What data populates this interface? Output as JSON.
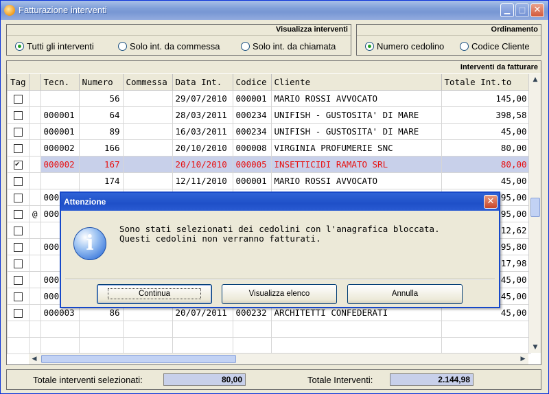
{
  "window": {
    "title": "Fatturazione interventi"
  },
  "filter_group": {
    "header": "Visualizza interventi",
    "options": [
      {
        "label": "Tutti gli interventi",
        "selected": true
      },
      {
        "label": "Solo int. da commessa",
        "selected": false
      },
      {
        "label": "Solo int. da chiamata",
        "selected": false
      }
    ]
  },
  "sort_group": {
    "header": "Ordinamento",
    "options": [
      {
        "label": "Numero cedolino",
        "selected": true
      },
      {
        "label": "Codice Cliente",
        "selected": false
      }
    ]
  },
  "grid": {
    "header": "Interventi da fatturare",
    "columns": [
      "Tag",
      "",
      "Tecn.",
      "Numero",
      "Commessa",
      "Data Int.",
      "Codice",
      "Cliente",
      "Totale Int.to"
    ],
    "rows": [
      {
        "tag": false,
        "flag": "",
        "tecn": "",
        "numero": "56",
        "commessa": "",
        "data": "29/07/2010",
        "codice": "000001",
        "cliente": "MARIO ROSSI AVVOCATO",
        "totale": "145,00"
      },
      {
        "tag": false,
        "flag": "",
        "tecn": "000001",
        "numero": "64",
        "commessa": "",
        "data": "28/03/2011",
        "codice": "000234",
        "cliente": "UNIFISH - GUSTOSITA' DI MARE",
        "totale": "398,58"
      },
      {
        "tag": false,
        "flag": "",
        "tecn": "000001",
        "numero": "89",
        "commessa": "",
        "data": "16/03/2011",
        "codice": "000234",
        "cliente": "UNIFISH - GUSTOSITA' DI MARE",
        "totale": "45,00"
      },
      {
        "tag": false,
        "flag": "",
        "tecn": "000002",
        "numero": "166",
        "commessa": "",
        "data": "20/10/2010",
        "codice": "000008",
        "cliente": "VIRGINIA PROFUMERIE SNC",
        "totale": "80,00"
      },
      {
        "tag": true,
        "flag": "",
        "tecn": "000002",
        "numero": "167",
        "commessa": "",
        "data": "20/10/2010",
        "codice": "000005",
        "cliente": "INSETTICIDI RAMATO SRL",
        "totale": "80,00",
        "selected": true
      },
      {
        "tag": false,
        "flag": "",
        "tecn": "",
        "numero": "174",
        "commessa": "",
        "data": "12/11/2010",
        "codice": "000001",
        "cliente": "MARIO ROSSI AVVOCATO",
        "totale": "45,00"
      },
      {
        "tag": false,
        "flag": "",
        "tecn": "000",
        "numero": "",
        "commessa": "",
        "data": "",
        "codice": "",
        "cliente": "",
        "totale": "95,00"
      },
      {
        "tag": false,
        "flag": "@",
        "tecn": "000",
        "numero": "",
        "commessa": "",
        "data": "",
        "codice": "",
        "cliente": "",
        "totale": "95,00"
      },
      {
        "tag": false,
        "flag": "",
        "tecn": "",
        "numero": "",
        "commessa": "",
        "data": "",
        "codice": "",
        "cliente": "",
        "totale": "12,62"
      },
      {
        "tag": false,
        "flag": "",
        "tecn": "000",
        "numero": "",
        "commessa": "",
        "data": "",
        "codice": "",
        "cliente": "",
        "totale": "95,80"
      },
      {
        "tag": false,
        "flag": "",
        "tecn": "",
        "numero": "",
        "commessa": "",
        "data": "",
        "codice": "",
        "cliente": "",
        "totale": "17,98"
      },
      {
        "tag": false,
        "flag": "",
        "tecn": "000",
        "numero": "",
        "commessa": "",
        "data": "",
        "codice": "",
        "cliente": "",
        "totale": "45,00"
      },
      {
        "tag": false,
        "flag": "",
        "tecn": "000",
        "numero": "",
        "commessa": "",
        "data": "",
        "codice": "",
        "cliente": "",
        "totale": "45,00"
      },
      {
        "tag": false,
        "flag": "",
        "tecn": "000003",
        "numero": "86",
        "commessa": "",
        "data": "20/07/2011",
        "codice": "000232",
        "cliente": "ARCHITETTI CONFEDERATI",
        "totale": "45,00"
      }
    ]
  },
  "totals": {
    "selected_label": "Totale interventi selezionati:",
    "selected_value": "80,00",
    "total_label": "Totale Interventi:",
    "total_value": "2.144,98"
  },
  "dialog": {
    "title": "Attenzione",
    "message_line1": "Sono stati selezionati dei cedolini con l'anagrafica bloccata.",
    "message_line2": "Questi cedolini non verranno fatturati.",
    "buttons": {
      "continue": "Continua",
      "view": "Visualizza elenco",
      "cancel": "Annulla"
    }
  }
}
